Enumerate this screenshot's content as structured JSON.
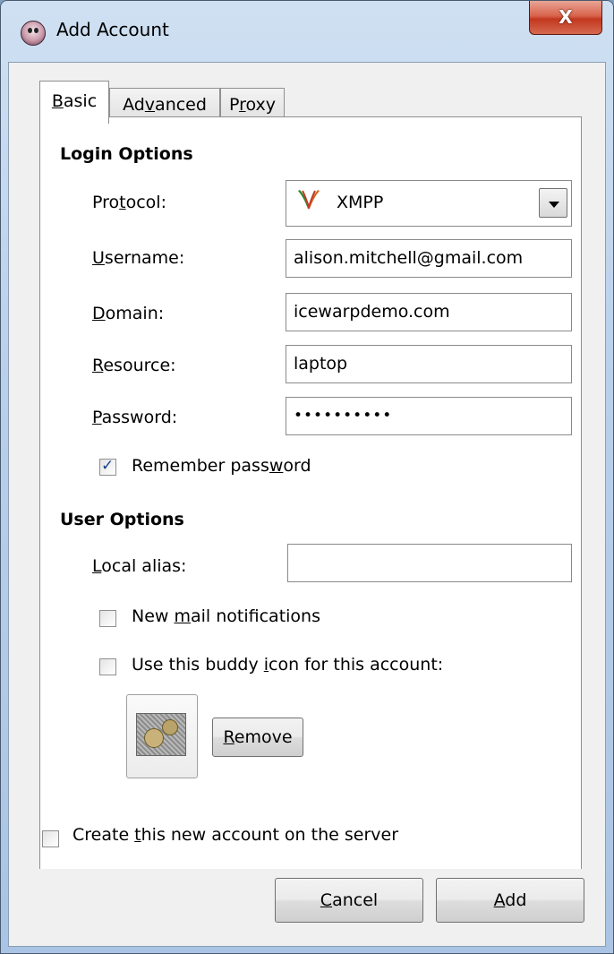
{
  "window": {
    "title": "Add Account",
    "close_label": "X"
  },
  "tabs": [
    {
      "label_pre": "",
      "label_ul": "B",
      "label_post": "asic"
    },
    {
      "label_pre": "Ad",
      "label_ul": "v",
      "label_post": "anced"
    },
    {
      "label_pre": "P",
      "label_ul": "r",
      "label_post": "oxy"
    }
  ],
  "login_options": {
    "title": "Login Options",
    "protocol": {
      "label_pre": "Pro",
      "label_ul": "t",
      "label_post": "ocol:",
      "value": "XMPP",
      "icon": "xmpp-protocol-icon"
    },
    "username": {
      "label_pre": "",
      "label_ul": "U",
      "label_post": "sername:",
      "value": "alison.mitchell@gmail.com"
    },
    "domain": {
      "label_pre": "",
      "label_ul": "D",
      "label_post": "omain:",
      "value": "icewarpdemo.com"
    },
    "resource": {
      "label_pre": "",
      "label_ul": "R",
      "label_post": "esource:",
      "value": "laptop"
    },
    "password": {
      "label_pre": "",
      "label_ul": "P",
      "label_post": "assword:",
      "value": "••••••••••"
    },
    "remember": {
      "label_pre": "Remember pass",
      "label_ul": "w",
      "label_post": "ord",
      "checked": true
    }
  },
  "user_options": {
    "title": "User Options",
    "local_alias": {
      "label_pre": "",
      "label_ul": "L",
      "label_post": "ocal alias:",
      "value": ""
    },
    "new_mail": {
      "label_pre": "New ",
      "label_ul": "m",
      "label_post": "ail notifications",
      "checked": false
    },
    "buddy_icon": {
      "label_pre": "Use this buddy ",
      "label_ul": "i",
      "label_post": "con for this account:",
      "checked": false
    },
    "remove": {
      "label_pre": "",
      "label_ul": "R",
      "label_post": "emove"
    }
  },
  "create_on_server": {
    "label_pre": "Create ",
    "label_ul": "t",
    "label_post": "his new account on the server",
    "checked": false
  },
  "buttons": {
    "cancel": {
      "label_pre": "",
      "label_ul": "C",
      "label_post": "ancel"
    },
    "add": {
      "label_pre": "",
      "label_ul": "A",
      "label_post": "dd"
    }
  }
}
